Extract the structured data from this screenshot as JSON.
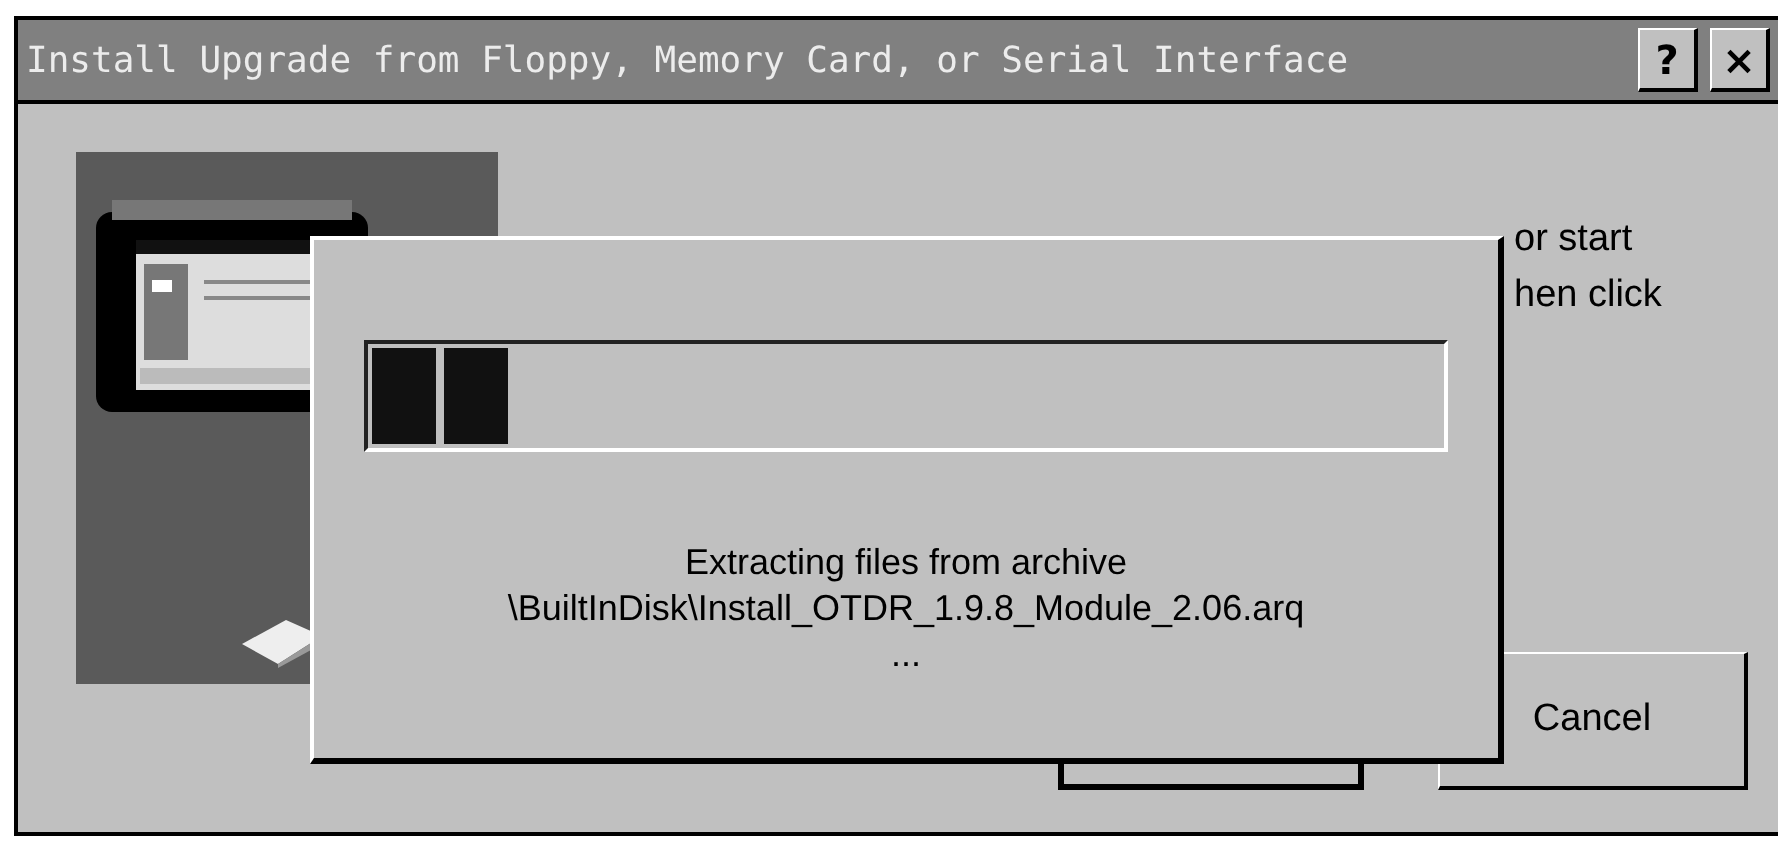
{
  "window": {
    "title": "Install Upgrade from Floppy, Memory Card, or Serial Interface",
    "help_button": "?",
    "close_button": "×"
  },
  "instructions": [
    "or start",
    "hen click"
  ],
  "buttons": [
    {
      "kind": "covered"
    },
    {
      "kind": "text",
      "label": "Cancel"
    }
  ],
  "progress_dialog": {
    "level": 0.13,
    "lines": [
      "Extracting files from archive",
      "\\BuiltInDisk\\Install_OTDR_1.9.8_Module_2.06.arq",
      "..."
    ]
  }
}
